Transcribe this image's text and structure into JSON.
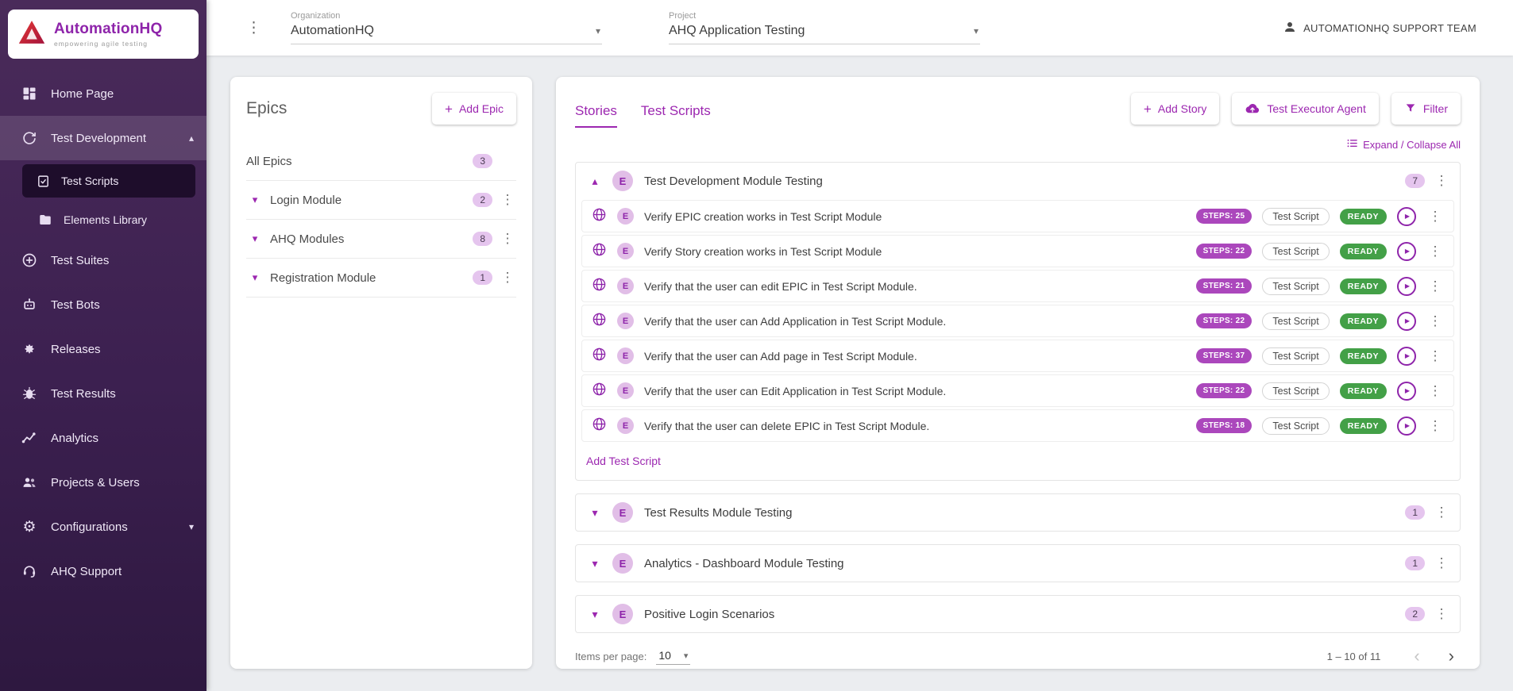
{
  "app": {
    "title": "AutomationHQ",
    "tagline": "empowering agile testing"
  },
  "topbar": {
    "organization_label": "Organization",
    "organization_value": "AutomationHQ",
    "project_label": "Project",
    "project_value": "AHQ Application Testing",
    "user_name": "AUTOMATIONHQ SUPPORT TEAM"
  },
  "sidebar": {
    "items": [
      {
        "label": "Home Page"
      },
      {
        "label": "Test Development"
      },
      {
        "label": "Test Scripts"
      },
      {
        "label": "Elements Library"
      },
      {
        "label": "Test Suites"
      },
      {
        "label": "Test Bots"
      },
      {
        "label": "Releases"
      },
      {
        "label": "Test Results"
      },
      {
        "label": "Analytics"
      },
      {
        "label": "Projects & Users"
      },
      {
        "label": "Configurations"
      },
      {
        "label": "AHQ Support"
      }
    ]
  },
  "epics": {
    "title": "Epics",
    "add_label": "Add Epic",
    "all": {
      "label": "All Epics",
      "count": "3"
    },
    "items": [
      {
        "label": "Login Module",
        "count": "2"
      },
      {
        "label": "AHQ Modules",
        "count": "8"
      },
      {
        "label": "Registration Module",
        "count": "1"
      }
    ]
  },
  "stories": {
    "tabs": {
      "stories": "Stories",
      "test_scripts": "Test Scripts"
    },
    "add_story_label": "Add Story",
    "executor_label": "Test Executor Agent",
    "filter_label": "Filter",
    "expand_collapse_label": "Expand / Collapse All",
    "group": {
      "title": "Test Development Module Testing",
      "count": "7",
      "add_link": "Add Test Script",
      "rows": [
        {
          "title": "Verify EPIC creation works in Test Script Module",
          "steps": "STEPS: 25",
          "type": "Test Script",
          "status": "READY"
        },
        {
          "title": "Verify Story creation works in Test Script Module",
          "steps": "STEPS: 22",
          "type": "Test Script",
          "status": "READY"
        },
        {
          "title": "Verify that the user can edit EPIC in Test Script Module.",
          "steps": "STEPS: 21",
          "type": "Test Script",
          "status": "READY"
        },
        {
          "title": "Verify that the user can Add Application in Test Script Module.",
          "steps": "STEPS: 22",
          "type": "Test Script",
          "status": "READY"
        },
        {
          "title": "Verify that the user can Add page in Test Script Module.",
          "steps": "STEPS: 37",
          "type": "Test Script",
          "status": "READY"
        },
        {
          "title": "Verify that the user can Edit Application in Test Script Module.",
          "steps": "STEPS: 22",
          "type": "Test Script",
          "status": "READY"
        },
        {
          "title": "Verify that the user can delete EPIC in Test Script Module.",
          "steps": "STEPS: 18",
          "type": "Test Script",
          "status": "READY"
        }
      ]
    },
    "collapsed_groups": [
      {
        "title": "Test Results Module Testing",
        "count": "1"
      },
      {
        "title": "Analytics - Dashboard Module Testing",
        "count": "1"
      },
      {
        "title": "Positive Login Scenarios",
        "count": "2"
      }
    ],
    "pagination": {
      "items_per_page_label": "Items per page:",
      "items_per_page_value": "10",
      "range": "1 – 10 of 11"
    }
  },
  "icons": {
    "plus": "+",
    "kebab": "⋮",
    "chevron_down": "▾",
    "chevron_up": "▴",
    "select_caret": "▾",
    "play": "▶",
    "prev": "‹",
    "next": "›",
    "epic_letter": "E"
  },
  "colors": {
    "accent": "#9c27b0",
    "accent_dark": "#8e24aa",
    "steps_badge": "#ab47bc",
    "ready_green": "#43a047",
    "badge_bg": "#e1bee7",
    "sidebar_top": "#4a2b5a",
    "sidebar_bottom": "#2e1840",
    "selected_item_bg": "#1e0d2b"
  }
}
